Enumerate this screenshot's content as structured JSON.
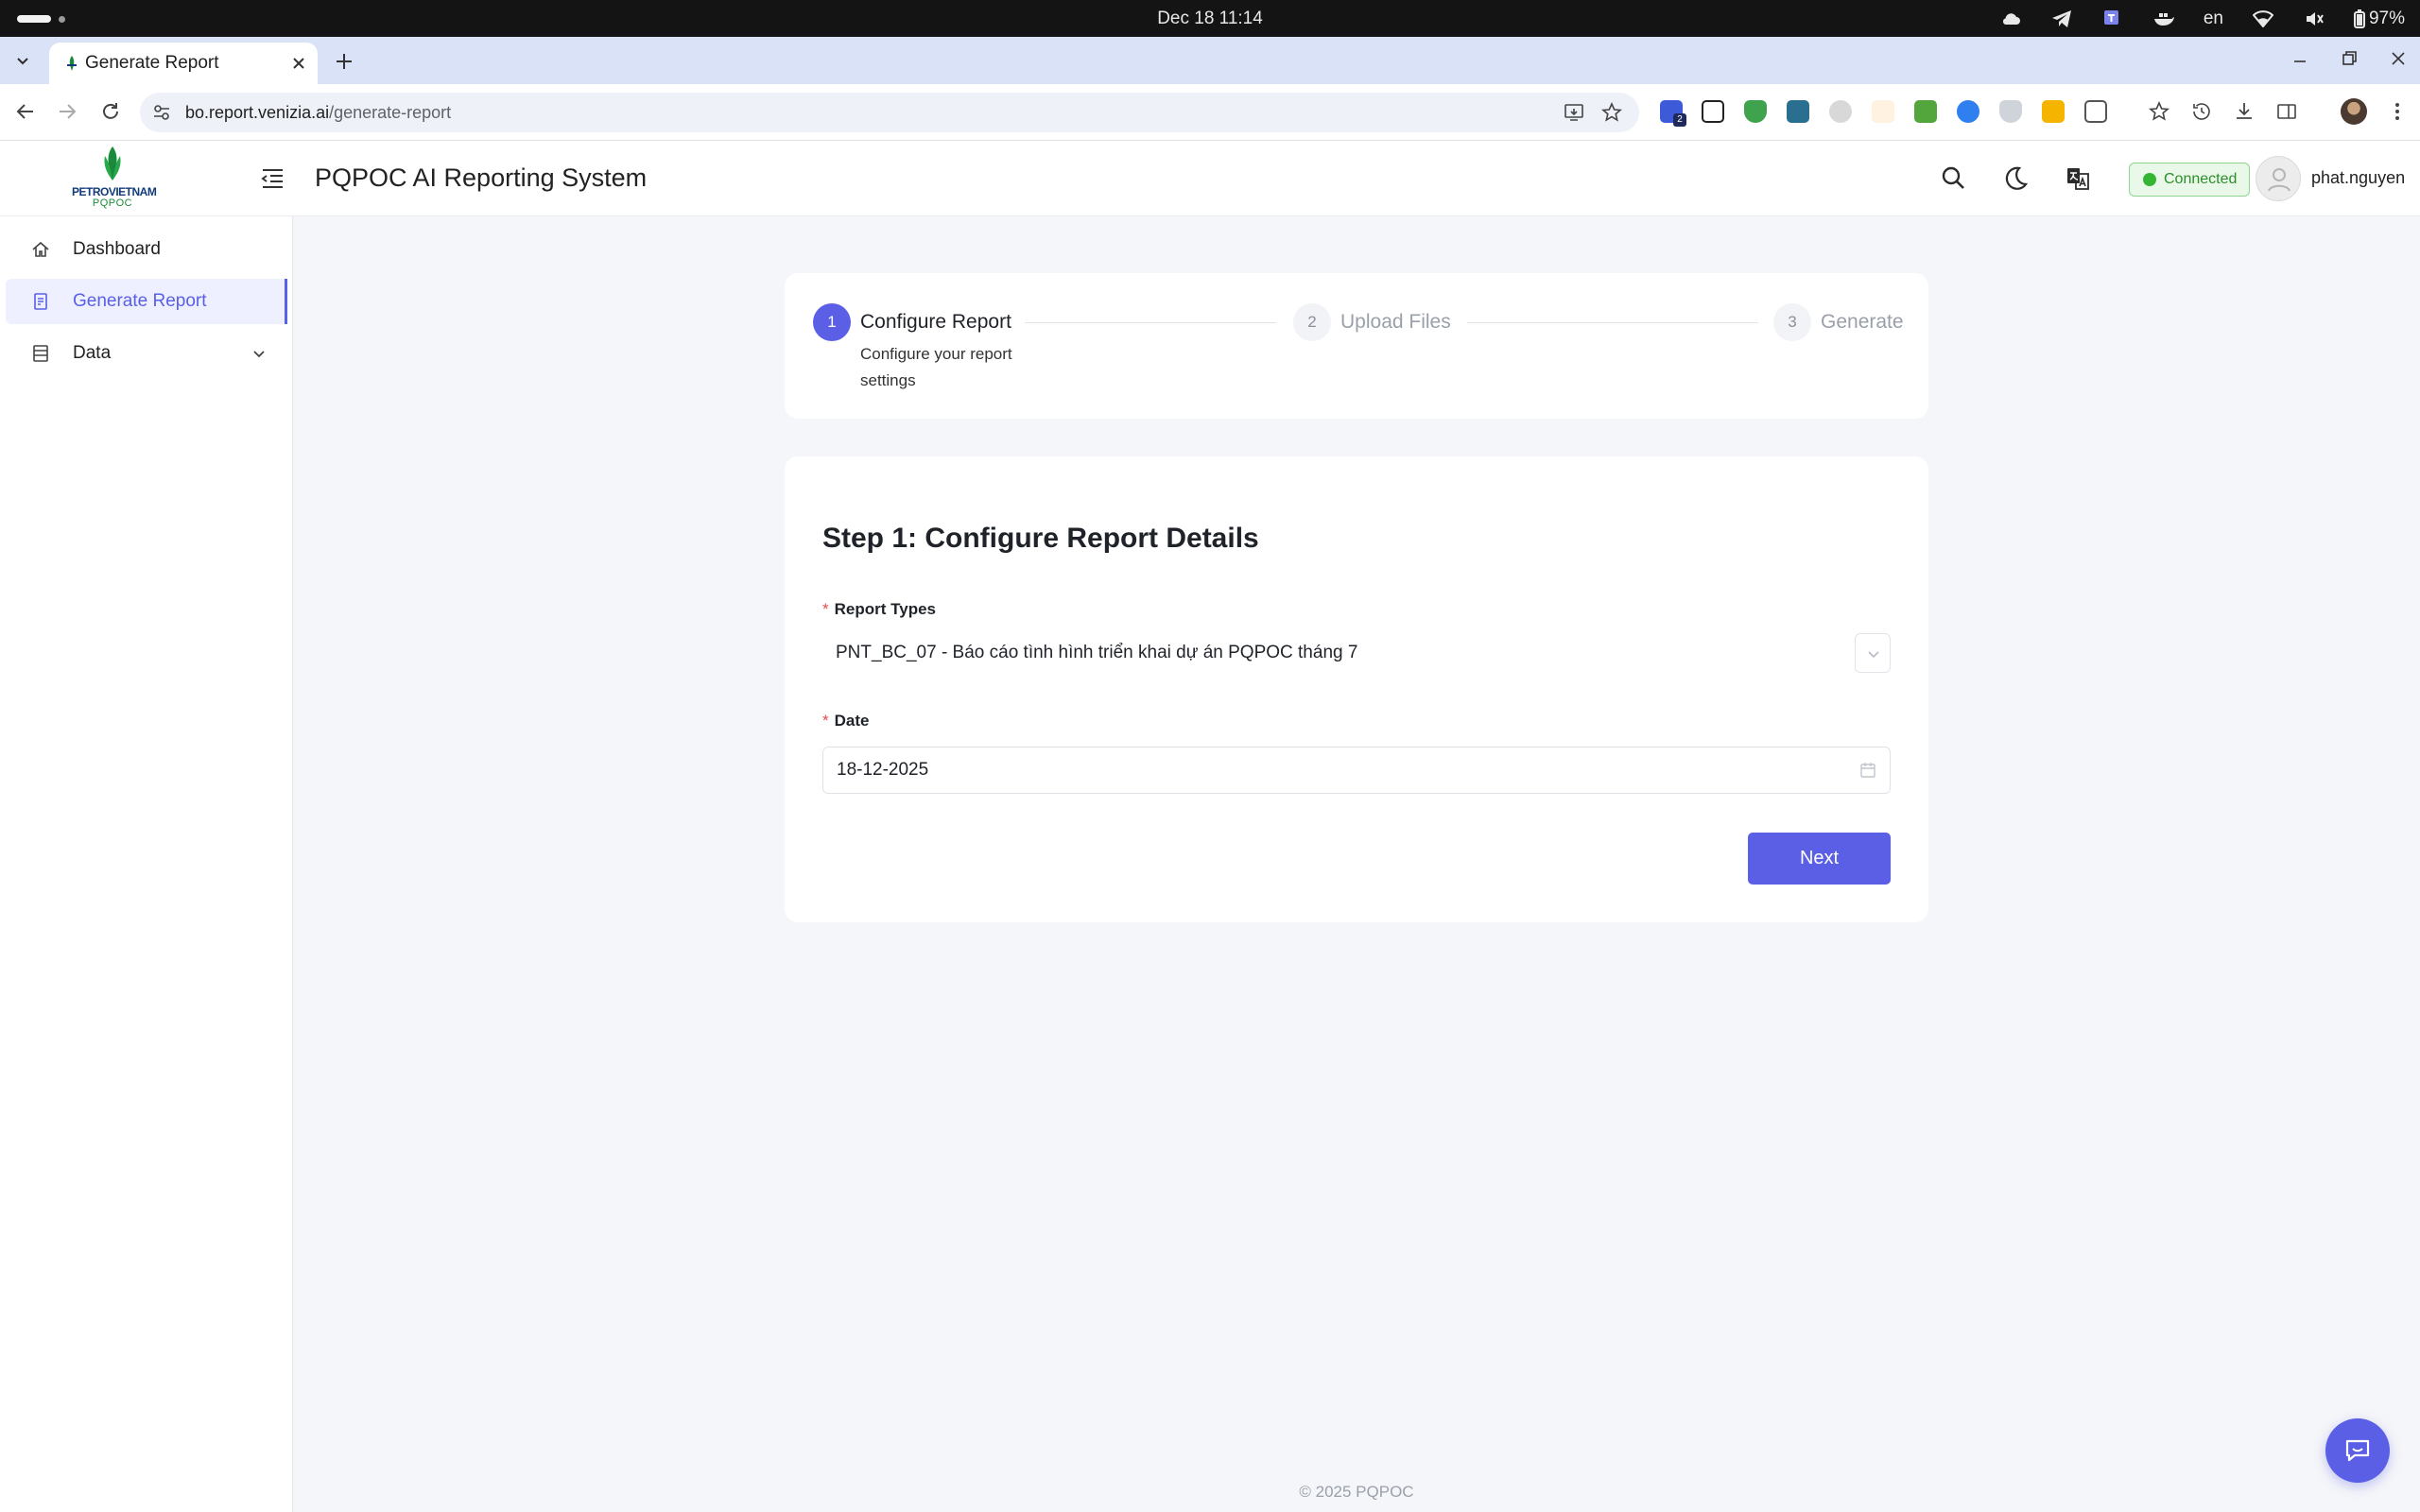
{
  "os": {
    "clock": "Dec 18  11:14",
    "language": "en",
    "battery": "97%"
  },
  "browser": {
    "tab_title": "Generate Report",
    "url_host": "bo.report.venizia.ai",
    "url_path": "/generate-report",
    "extension_badge": "2"
  },
  "header": {
    "logo_line1": "PETROVIETNAM",
    "logo_line2": "PQPOC",
    "app_title": "PQPOC AI Reporting System",
    "status_badge": "Connected",
    "username": "phat.nguyen"
  },
  "sidebar": {
    "items": [
      {
        "label": "Dashboard",
        "icon": "home-icon",
        "active": false
      },
      {
        "label": "Generate Report",
        "icon": "report-icon",
        "active": true
      },
      {
        "label": "Data",
        "icon": "data-icon",
        "active": false,
        "expandable": true
      }
    ]
  },
  "steps": [
    {
      "number": "1",
      "title": "Configure Report",
      "description": "Configure your report settings",
      "state": "active"
    },
    {
      "number": "2",
      "title": "Upload Files",
      "state": "pending"
    },
    {
      "number": "3",
      "title": "Generate",
      "state": "pending"
    }
  ],
  "form": {
    "title": "Step 1: Configure Report Details",
    "report_types_label": "Report Types",
    "report_types_value": "PNT_BC_07 - Báo cáo tình hình triển khai dự án PQPOC tháng 7",
    "date_label": "Date",
    "date_value": "18-12-2025",
    "required_mark": "*",
    "next_label": "Next"
  },
  "footer": {
    "text": "© 2025 PQPOC"
  },
  "colors": {
    "accent": "#5a5fe6",
    "status_green": "#34b634",
    "required_red": "#e34a4a"
  }
}
